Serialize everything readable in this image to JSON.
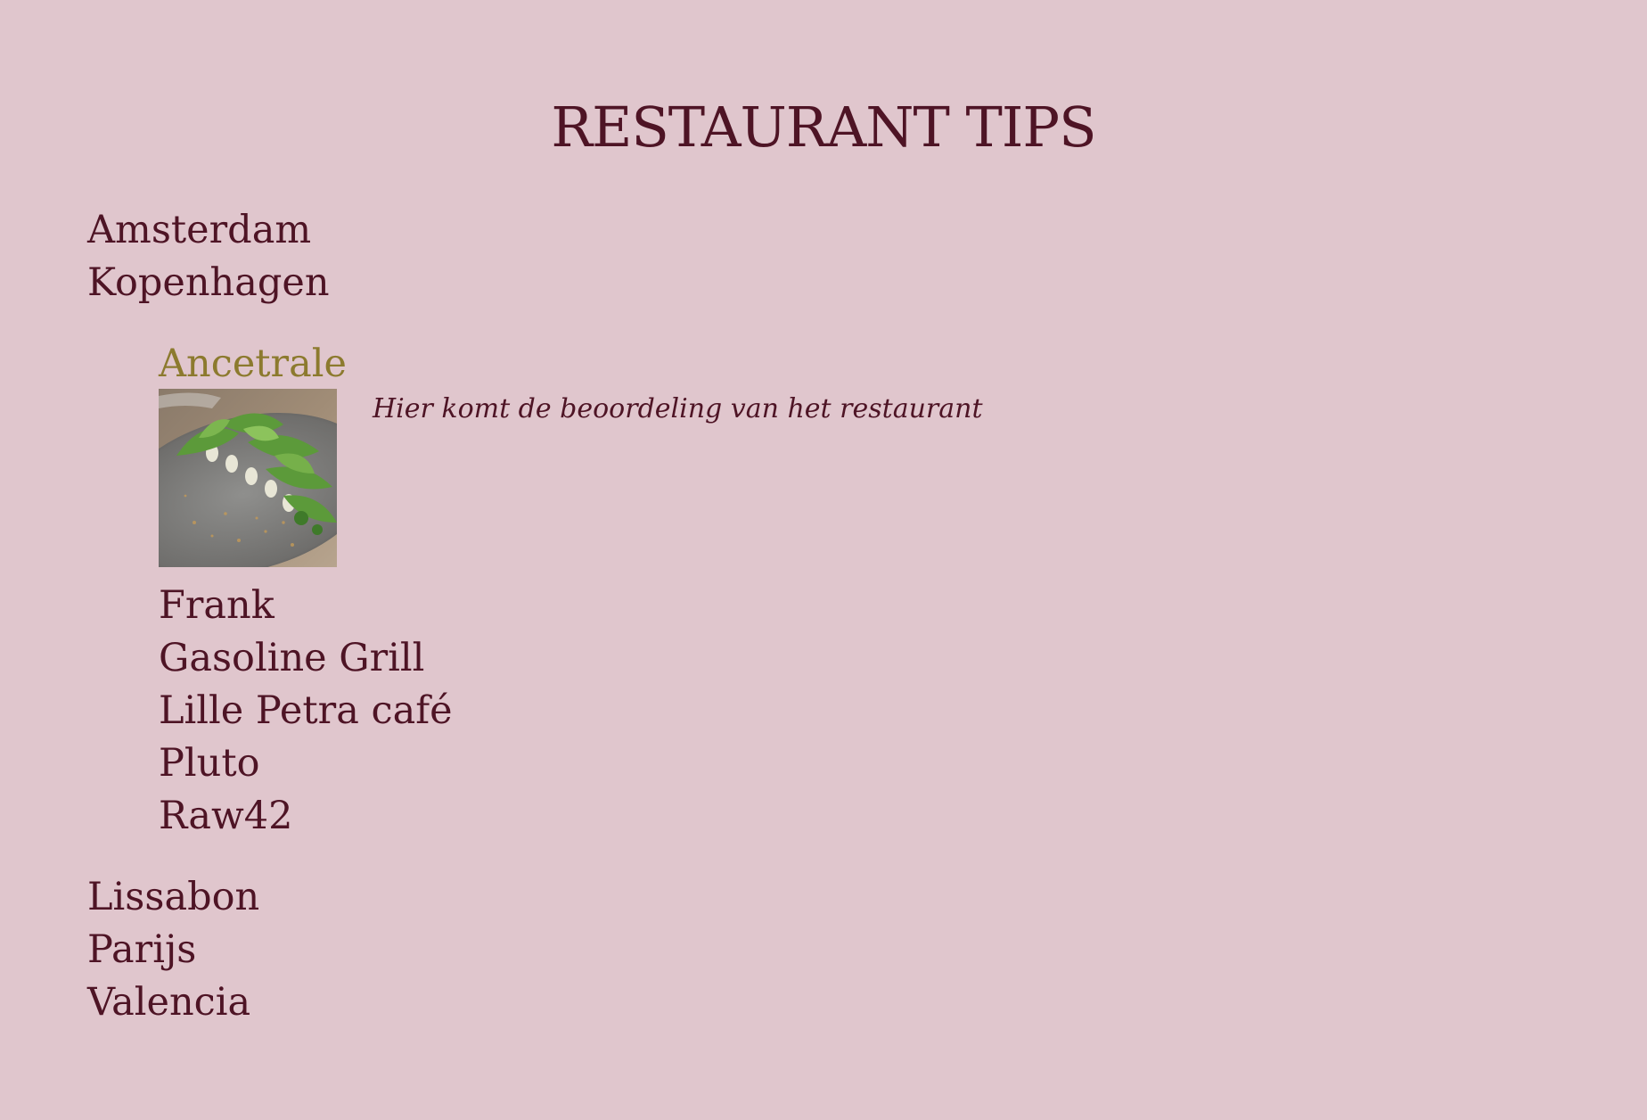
{
  "page": {
    "title": "RESTAURANT TIPS"
  },
  "colors": {
    "background": "#e0c6cd",
    "text": "#4e1425",
    "active_item": "#8c7a2e"
  },
  "cities": [
    {
      "name": "Amsterdam"
    },
    {
      "name": "Kopenhagen",
      "restaurants": [
        {
          "name": "Ancetrale",
          "active": true,
          "image_icon": "dish-photo",
          "review": "Hier komt de beoordeling van het restaurant"
        },
        {
          "name": "Frank"
        },
        {
          "name": "Gasoline Grill"
        },
        {
          "name": "Lille Petra café"
        },
        {
          "name": "Pluto"
        },
        {
          "name": "Raw42"
        }
      ]
    },
    {
      "name": "Lissabon"
    },
    {
      "name": "Parijs"
    },
    {
      "name": "Valencia"
    }
  ]
}
